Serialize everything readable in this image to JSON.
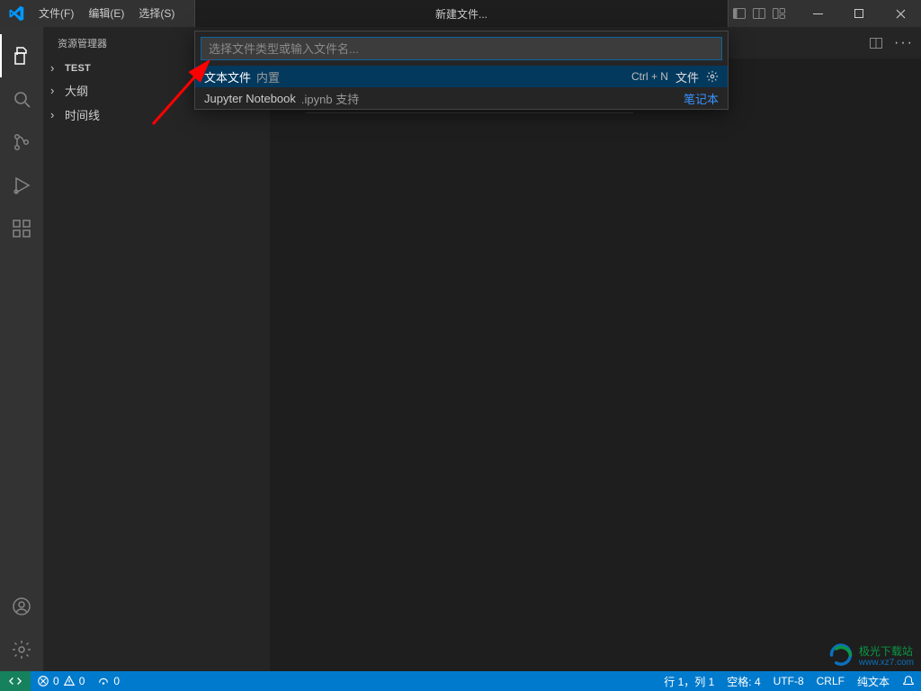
{
  "titlebar": {
    "menu": {
      "file": "文件(F)",
      "edit": "编辑(E)",
      "select": "选择(S)"
    },
    "dialog_title": "新建文件..."
  },
  "sidebar": {
    "title": "资源管理器",
    "sections": {
      "test": "TEST",
      "outline": "大纲",
      "timeline": "时间线"
    }
  },
  "quickopen": {
    "placeholder": "选择文件类型或输入文件名...",
    "rows": [
      {
        "name": "文本文件",
        "hint": "内置",
        "keybinding": "Ctrl  +  N",
        "category": "文件",
        "gear": true
      },
      {
        "name": "Jupyter Notebook",
        "hint": ".ipynb 支持",
        "link": "笔记本"
      }
    ]
  },
  "statusbar": {
    "errors": "0",
    "warnings": "0",
    "ports": "0",
    "line_col": "行 1，列 1",
    "spaces": "空格: 4",
    "encoding": "UTF-8",
    "eol": "CRLF",
    "lang": "纯文本"
  },
  "watermark": {
    "name": "极光下载站",
    "sub": "www.xz7.com"
  }
}
